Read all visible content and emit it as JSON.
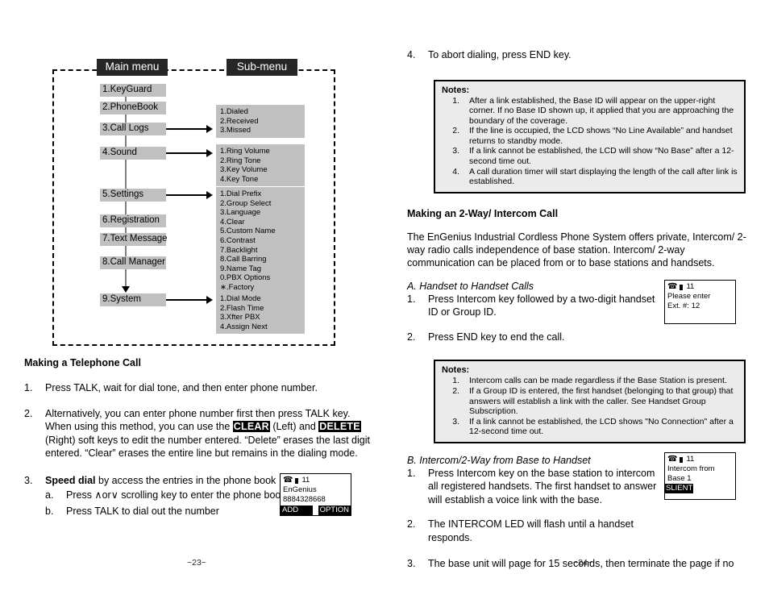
{
  "diagram": {
    "main_menu_header": "Main menu",
    "sub_menu_header": "Sub-menu",
    "main_items": [
      "1.KeyGuard",
      "2.PhoneBook",
      "3.Call Logs",
      "4.Sound",
      "5.Settings",
      "6.Registration",
      "7.Text Message",
      "8.Call Manager",
      "9.System"
    ],
    "sub_groups": [
      {
        "parent": "3.Call Logs",
        "items": [
          "1.Dialed",
          "2.Received",
          "3.Missed"
        ]
      },
      {
        "parent": "4.Sound",
        "items": [
          "1.Ring Volume",
          "2.Ring Tone",
          "3.Key Volume",
          "4.Key Tone"
        ]
      },
      {
        "parent": "5.Settings",
        "items": [
          "1.Dial Prefix",
          "2.Group Select",
          "3.Language",
          "4.Clear",
          "5.Custom Name",
          "6.Contrast",
          "7.Backlight",
          "8.Call Barring",
          "9.Name Tag",
          "0.PBX Options",
          "∗.Factory"
        ]
      },
      {
        "parent": "9.System",
        "items": [
          "1.Dial Mode",
          "2.Flash Time",
          "3.Xfter PBX",
          "4.Assign Next"
        ]
      }
    ]
  },
  "left": {
    "heading": "Making a Telephone Call",
    "item1_num": "1.",
    "item1_text": "Press TALK, wait for dial tone, and then enter phone number.",
    "item2_num": "2.",
    "item2_part1": "Alternatively, you can enter phone number first then press TALK key. When using this method, you can use the ",
    "item2_clear": "CLEAR",
    "item2_part2": " (Left) and ",
    "item2_delete": "DELETE",
    "item2_part3": " (Right) soft keys to edit the number entered.  “Delete” erases the last digit entered.  “Clear” erases the entire line but remains in the dialing mode.",
    "item3_num": "3.",
    "item3_bold": "Speed dial",
    "item3_rest": " by access the entries in the phone book",
    "item3a_num": "a.",
    "item3a_text": "Press ∧or∨ scrolling key to enter the phone book",
    "item3b_num": "b.",
    "item3b_text": "Press TALK to dial out the number",
    "page_number": "~23~"
  },
  "lcd_phonebook": {
    "id": "11",
    "line1": "EnGenius",
    "line2": "8884328668",
    "softkey_left": "ADD",
    "softkey_right": "OPTION"
  },
  "lcd_intercom_ext": {
    "id": "11",
    "line1": "Please enter",
    "line2": "Ext. #: 12"
  },
  "lcd_intercom_base": {
    "id": "11",
    "line1": "Intercom from",
    "line2": "Base 1",
    "line3": "SLIENT"
  },
  "right": {
    "item4_num": "4.",
    "item4_text": "To abort dialing, press END key.",
    "notes1_title": "Notes:",
    "notes1": [
      {
        "n": "1.",
        "t": "After a link established, the Base ID will appear on the upper-right corner.  If no Base ID shown up, it applied that you are approaching the boundary of the coverage."
      },
      {
        "n": "2.",
        "t": "If the line is occupied, the LCD shows “No Line Available” and handset returns to standby mode."
      },
      {
        "n": "3.",
        "t": "If a link cannot be established, the LCD will show “No Base” after a 12-second time out."
      },
      {
        "n": "4.",
        "t": "A call duration timer will start displaying the length of the call after link is established."
      }
    ],
    "heading2": "Making an 2-Way/ Intercom Call",
    "para1": "The EnGenius Industrial Cordless Phone System offers private, Intercom/ 2-way radio calls independence of base station.  Intercom/ 2-way communication can be placed from or to base stations and handsets.",
    "sectionA": "A. Handset to Handset Calls",
    "a1_num": "1.",
    "a1_text": "Press Intercom key followed by a two-digit handset ID or Group ID.",
    "a2_num": "2.",
    "a2_text": "Press END key to end the call.",
    "notes2_title": "Notes:",
    "notes2": [
      {
        "n": "1.",
        "t": "Intercom calls can be made regardless if the Base Station is present."
      },
      {
        "n": "2.",
        "t": "If a Group ID is entered, the first handset (belonging to that group) that answers will establish a link with the caller.  See Handset Group Subscription."
      },
      {
        "n": "3.",
        "t": "If a link cannot be established, the LCD shows \"No Connection\" after a 12-second time out."
      }
    ],
    "sectionB": "B. Intercom/2-Way from Base to Handset",
    "b1_num": "1.",
    "b1_text": "Press Intercom key on the base station to intercom all registered handsets. The first handset to answer will establish a voice link with the base.",
    "b2_num": "2.",
    "b2_text": "The INTERCOM LED will flash until a handset responds.",
    "b3_num": "3.",
    "b3_text": "The base unit will page for 15 seconds, then terminate the page if no",
    "page_number": "~24~"
  }
}
